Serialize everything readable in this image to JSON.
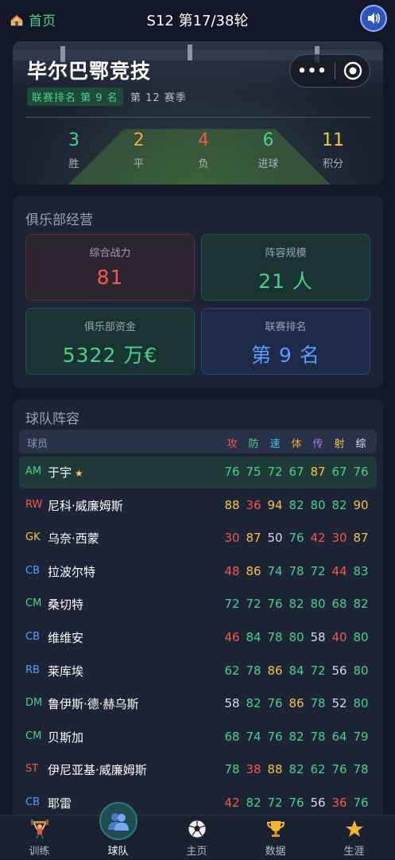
{
  "topbar": {
    "home_label": "首页",
    "title": "S12 第17/38轮",
    "sound_icon": "speaker-icon"
  },
  "hero": {
    "club_name": "毕尔巴鄂竞技",
    "league_rank": "联赛排名 第 9 名",
    "season": "第 12 赛季",
    "capsule_more": "•••",
    "stats": [
      {
        "value": "3",
        "label": "胜",
        "color": "#4bd08a"
      },
      {
        "value": "2",
        "label": "平",
        "color": "#f5a63a"
      },
      {
        "value": "4",
        "label": "负",
        "color": "#f15a4a"
      },
      {
        "value": "6",
        "label": "进球",
        "color": "#4bd08a"
      },
      {
        "value": "11",
        "label": "积分",
        "color": "#f5c542"
      }
    ]
  },
  "club": {
    "title": "俱乐部经营",
    "tiles": [
      {
        "label": "综合战力",
        "value": "81",
        "color": "#f15a4a"
      },
      {
        "label": "阵容规模",
        "value": "21 人",
        "color": "#4bd08a"
      },
      {
        "label": "俱乐部资金",
        "value": "5322 万€",
        "color": "#4bd08a"
      },
      {
        "label": "联赛排名",
        "value": "第 9 名",
        "color": "#5b9bff"
      }
    ]
  },
  "squad": {
    "title": "球队阵容",
    "header": {
      "player": "球员",
      "attrs": [
        {
          "label": "攻",
          "color": "#f15a4a"
        },
        {
          "label": "防",
          "color": "#4bd08a"
        },
        {
          "label": "速",
          "color": "#3fc7e0"
        },
        {
          "label": "体",
          "color": "#f5a63a"
        },
        {
          "label": "传",
          "color": "#b07cf2"
        },
        {
          "label": "射",
          "color": "#f5c542"
        },
        {
          "label": "综",
          "color": "#e6e9f0"
        }
      ]
    },
    "players": [
      {
        "pos": "AM",
        "posColor": "#4bd08a",
        "name": "于宇",
        "star": "★",
        "vals": [
          76,
          75,
          72,
          67,
          87,
          67,
          76
        ],
        "highlight": true
      },
      {
        "pos": "RW",
        "posColor": "#f15a4a",
        "name": "尼科·威廉姆斯",
        "star": "",
        "vals": [
          88,
          36,
          94,
          82,
          80,
          82,
          90
        ],
        "highlight": false
      },
      {
        "pos": "GK",
        "posColor": "#f5c542",
        "name": "乌奈·西蒙",
        "star": "",
        "vals": [
          30,
          87,
          50,
          76,
          42,
          30,
          87
        ],
        "highlight": false
      },
      {
        "pos": "CB",
        "posColor": "#5b9bff",
        "name": "拉波尔特",
        "star": "",
        "vals": [
          48,
          86,
          74,
          78,
          72,
          44,
          83
        ],
        "highlight": false
      },
      {
        "pos": "CM",
        "posColor": "#4bd08a",
        "name": "桑切特",
        "star": "",
        "vals": [
          72,
          72,
          76,
          82,
          80,
          68,
          82
        ],
        "highlight": false
      },
      {
        "pos": "CB",
        "posColor": "#5b9bff",
        "name": "维维安",
        "star": "",
        "vals": [
          46,
          84,
          78,
          80,
          58,
          40,
          80
        ],
        "highlight": false
      },
      {
        "pos": "RB",
        "posColor": "#5b9bff",
        "name": "莱库埃",
        "star": "",
        "vals": [
          62,
          78,
          86,
          84,
          72,
          56,
          80
        ],
        "highlight": false
      },
      {
        "pos": "DM",
        "posColor": "#4bd08a",
        "name": "鲁伊斯·德·赫乌斯",
        "star": "",
        "vals": [
          58,
          82,
          76,
          86,
          78,
          52,
          80
        ],
        "highlight": false
      },
      {
        "pos": "CM",
        "posColor": "#4bd08a",
        "name": "贝斯加",
        "star": "",
        "vals": [
          68,
          74,
          76,
          82,
          78,
          64,
          79
        ],
        "highlight": false
      },
      {
        "pos": "ST",
        "posColor": "#f15a4a",
        "name": "伊尼亚基·威廉姆斯",
        "star": "",
        "vals": [
          78,
          38,
          88,
          82,
          62,
          76,
          78
        ],
        "highlight": false
      },
      {
        "pos": "CB",
        "posColor": "#5b9bff",
        "name": "耶雷",
        "star": "",
        "vals": [
          42,
          82,
          72,
          76,
          56,
          36,
          76
        ],
        "highlight": false
      }
    ]
  },
  "tabbar": {
    "tabs": [
      {
        "label": "训练",
        "icon": "weightlifter-icon"
      },
      {
        "label": "球队",
        "icon": "team-icon"
      },
      {
        "label": "主页",
        "icon": "soccer-ball-icon"
      },
      {
        "label": "数据",
        "icon": "trophy-icon"
      },
      {
        "label": "生涯",
        "icon": "star-icon"
      }
    ]
  }
}
